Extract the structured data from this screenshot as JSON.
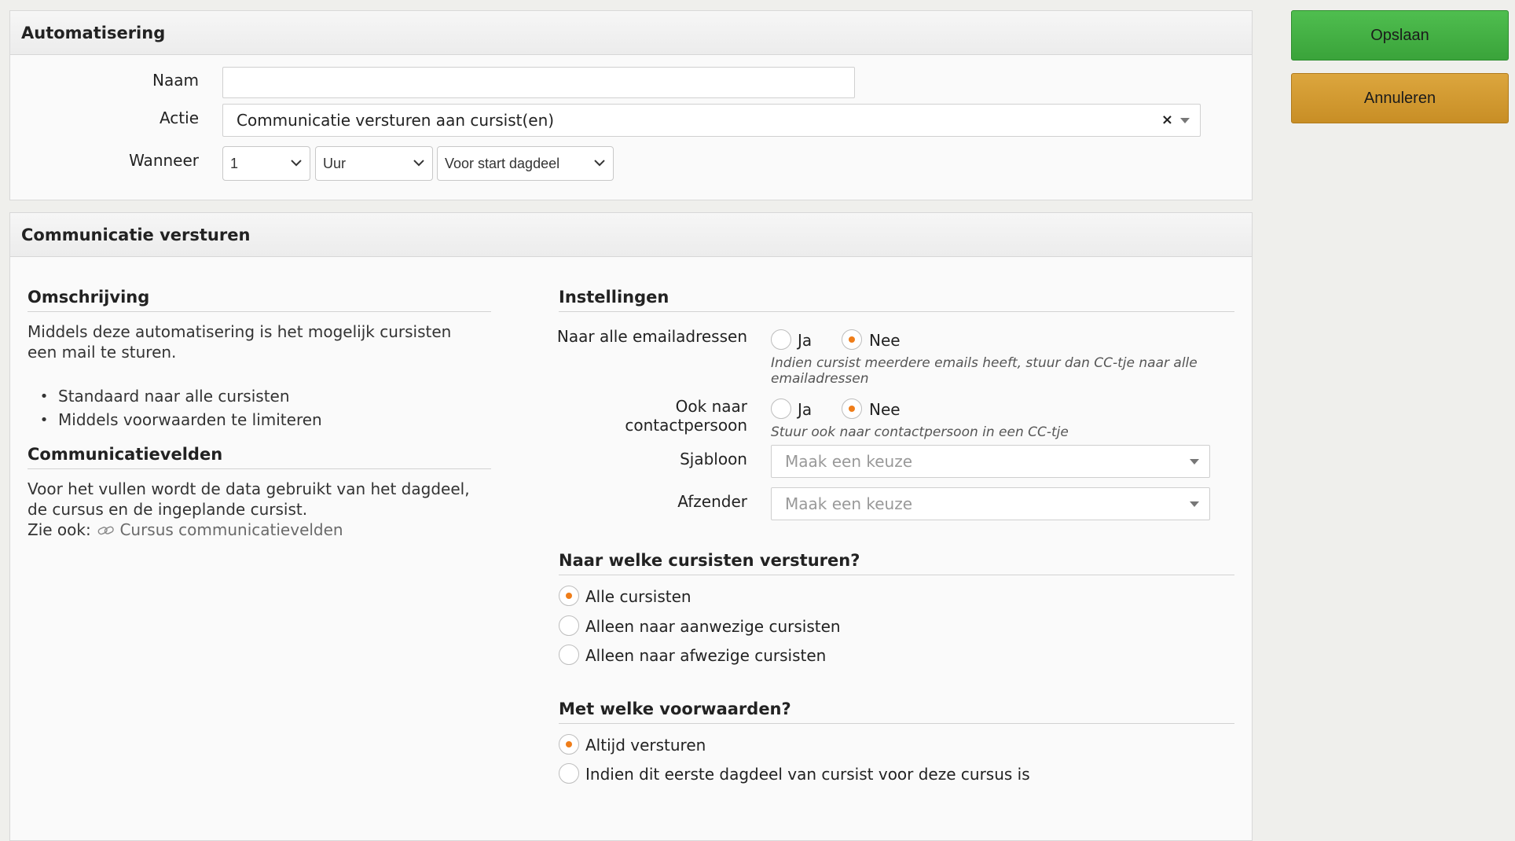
{
  "automatisering": {
    "title": "Automatisering",
    "naam_label": "Naam",
    "naam_value": "",
    "actie_label": "Actie",
    "actie_value": "Communicatie versturen aan cursist(en)",
    "actie_clear": "×",
    "wanneer_label": "Wanneer",
    "wanneer_amount": "1",
    "wanneer_unit": "Uur",
    "wanneer_moment": "Voor start dagdeel"
  },
  "buttons": {
    "save": "Opslaan",
    "cancel": "Annuleren"
  },
  "communicatie": {
    "title": "Communicatie versturen",
    "omschrijving": {
      "title": "Omschrijving",
      "text": "Middels deze automatisering is het mogelijk cursisten een mail te sturen.",
      "bullets": [
        "Standaard naar alle cursisten",
        "Middels voorwaarden te limiteren"
      ]
    },
    "velden": {
      "title": "Communicatievelden",
      "text": "Voor het vullen wordt de data gebruikt van het dagdeel, de cursus en de ingeplande cursist.",
      "zie_ook": "Zie ook:",
      "link": "Cursus communicatievelden"
    },
    "instellingen": {
      "title": "Instellingen",
      "alle_emails": {
        "label": "Naar alle emailadressen",
        "ja": "Ja",
        "nee": "Nee",
        "selected": "Nee",
        "help": "Indien cursist meerdere emails heeft, stuur dan CC-tje naar alle emailadressen"
      },
      "contactpersoon": {
        "label": "Ook naar contactpersoon",
        "ja": "Ja",
        "nee": "Nee",
        "selected": "Nee",
        "help": "Stuur ook naar contactpersoon in een CC-tje"
      },
      "sjabloon": {
        "label": "Sjabloon",
        "placeholder": "Maak een keuze"
      },
      "afzender": {
        "label": "Afzender",
        "placeholder": "Maak een keuze"
      }
    },
    "cursisten": {
      "title": "Naar welke cursisten versturen?",
      "options": [
        "Alle cursisten",
        "Alleen naar aanwezige cursisten",
        "Alleen naar afwezige cursisten"
      ],
      "selected": "Alle cursisten"
    },
    "voorwaarden": {
      "title": "Met welke voorwaarden?",
      "options": [
        "Altijd versturen",
        "Indien dit eerste dagdeel van cursist voor deze cursus is"
      ],
      "selected": "Altijd versturen"
    }
  },
  "colors": {
    "accent_radio": "#ef7d19",
    "save_button": "#44b044",
    "cancel_button": "#d29a30"
  }
}
